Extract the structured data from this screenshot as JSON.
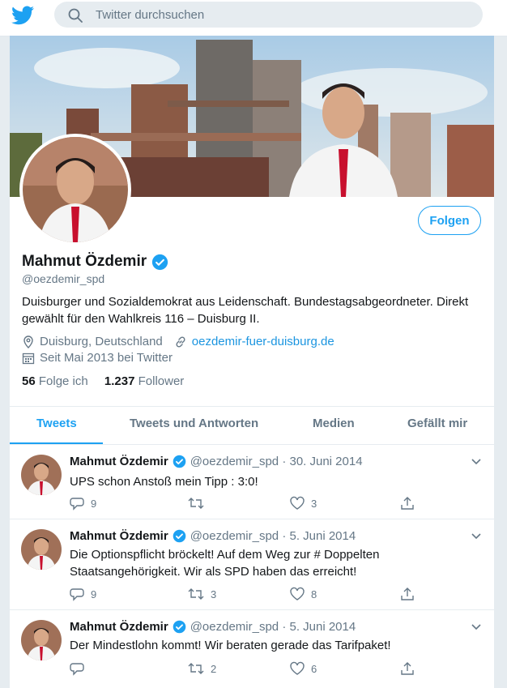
{
  "search": {
    "placeholder": "Twitter durchsuchen"
  },
  "profile": {
    "name": "Mahmut Özdemir",
    "handle": "@oezdemir_spd",
    "bio": "Duisburger und Sozialdemokrat aus Leidenschaft. Bundestagsabgeordneter. Direkt gewählt für den Wahlkreis 116 – Duisburg II.",
    "location": "Duisburg, Deutschland",
    "website": "oezdemir-fuer-duisburg.de",
    "joined": "Seit Mai 2013 bei Twitter",
    "following_count": "56",
    "following_label": "Folge ich",
    "followers_count": "1.237",
    "followers_label": "Follower",
    "follow_button": "Folgen"
  },
  "tabs": [
    {
      "label": "Tweets",
      "active": true
    },
    {
      "label": "Tweets und Antworten",
      "active": false
    },
    {
      "label": "Medien",
      "active": false
    },
    {
      "label": "Gefällt mir",
      "active": false
    }
  ],
  "tweets": [
    {
      "author": "Mahmut Özdemir",
      "handle": "@oezdemir_spd",
      "date": "· 30. Juni 2014",
      "text": "UPS schon Anstoß mein Tipp : 3:0!",
      "replies": "9",
      "retweets": "",
      "likes": "3"
    },
    {
      "author": "Mahmut Özdemir",
      "handle": "@oezdemir_spd",
      "date": "· 5. Juni 2014",
      "text": "Die Optionspflicht bröckelt! Auf dem Weg zur # Doppelten Staatsangehörigkeit. Wir als SPD haben das erreicht!",
      "replies": "9",
      "retweets": "3",
      "likes": "8"
    },
    {
      "author": "Mahmut Özdemir",
      "handle": "@oezdemir_spd",
      "date": "· 5. Juni 2014",
      "text": "Der Mindestlohn kommt! Wir beraten gerade das Tarifpaket!",
      "replies": "",
      "retweets": "2",
      "likes": "6"
    }
  ],
  "colors": {
    "accent": "#1da1f2",
    "verified": "#1da1f2",
    "text": "#14171a",
    "muted": "#657786"
  }
}
